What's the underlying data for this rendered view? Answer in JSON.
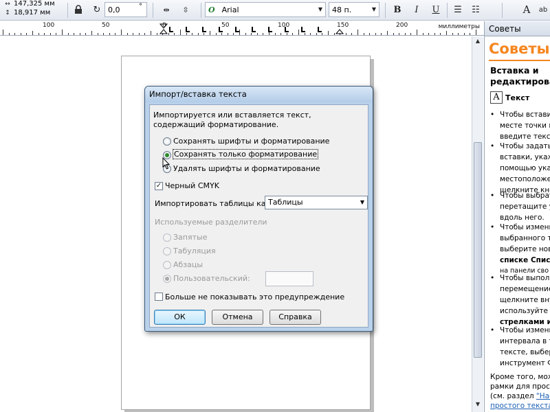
{
  "propbar": {
    "coord_x": "147,325 мм",
    "coord_y": "18,917 мм",
    "rotation": "0,0",
    "rotation_unit": "°",
    "font_name": "Arial",
    "font_size": "48 п.",
    "glyph_ab": "ab"
  },
  "ruler": {
    "numbers": [
      "100",
      "50",
      "0",
      "50",
      "100",
      "150",
      "200"
    ],
    "units": "миллиметры"
  },
  "docker": {
    "tab_label": "Советы",
    "title": "Советы",
    "section_line1": "Вставка и",
    "section_line2": "редактирова",
    "text_icon": "A",
    "text_label": "Текст",
    "bullet": "•",
    "lines": [
      "Чтобы вставит",
      "месте точки в",
      "введите текст",
      "Чтобы задать",
      "вставки, укаж",
      "помощью указ",
      "местоположен",
      "щелкните кноп",
      "Чтобы выбрат",
      "перетащите у",
      "вдоль него.",
      "Чтобы измени",
      "выбранного те",
      "выберите нов",
      "списке Списо",
      "на панели сво",
      "Чтобы выполн",
      "перемещение",
      "щелкните внут",
      "используйте к",
      "стрелками ил",
      "Чтобы измени",
      "интервала в т",
      "тексте, выбер",
      "инструмент Ф"
    ],
    "footer_line1": "Кроме того, мож",
    "footer_line2": "рамки для прост",
    "footer_line3_pre": "(см. раздел ",
    "footer_line3_link": "\"Нас",
    "footer_line4_link": "простого текста"
  },
  "dialog": {
    "title": "Импорт/вставка текста",
    "message_line1": "Импортируется или вставляется текст,",
    "message_line2": "содержащий форматирование.",
    "radio_keep_fonts": "Сохранять шрифты и форматирование",
    "radio_keep_formatting": "Сохранять только форматирование",
    "radio_remove": "Удалять шрифты и форматирование",
    "check_cmyk": "Черный CMYK",
    "check_mark": "✓",
    "tables_label": "Импортировать таблицы как:",
    "tables_value": "Таблицы",
    "separators_label": "Используемые разделители",
    "sep_comma": "Запятые",
    "sep_tab": "Табуляция",
    "sep_paragraph": "Абзацы",
    "sep_custom": "Пользовательский:",
    "dont_show": "Больше не показывать это предупреждение",
    "ok": "ОК",
    "cancel": "Отмена",
    "help": "Справка"
  }
}
